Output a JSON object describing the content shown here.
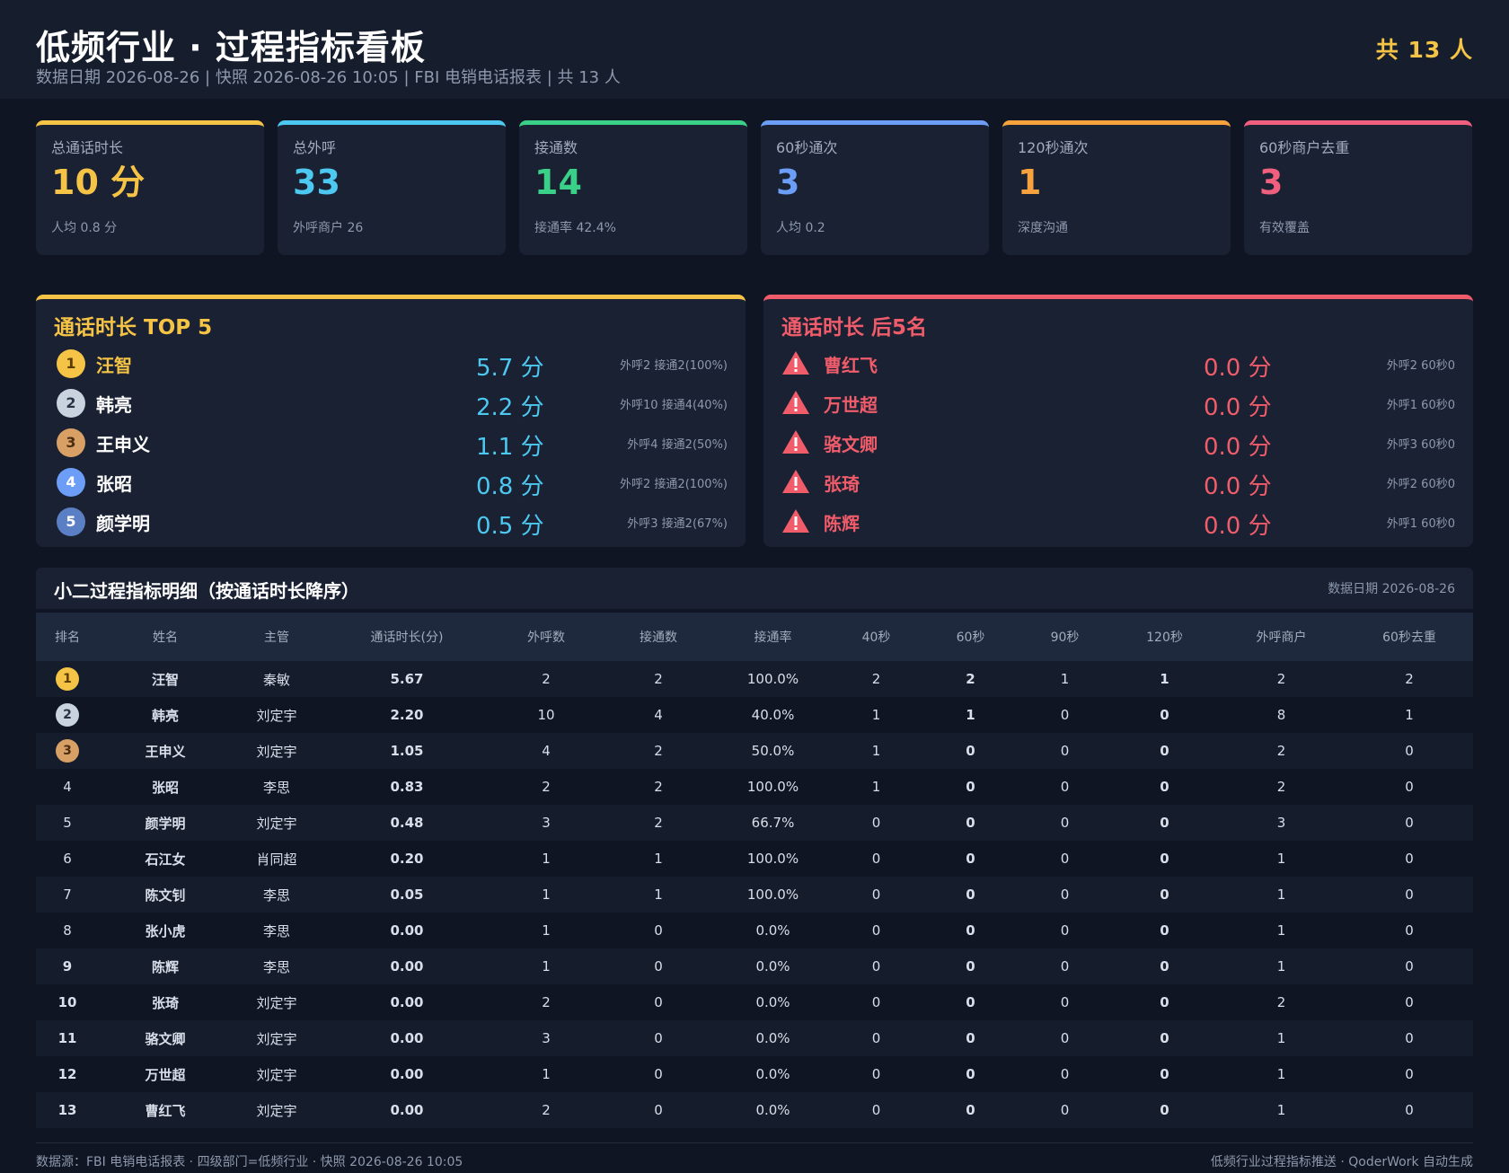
{
  "header": {
    "title": "低频行业 · 过程指标看板",
    "subtitle": "数据日期 2026-08-26 | 快照 2026-08-26 10:05 | FBI 电销电话报表 | 共 13 人",
    "total": "共 13 人"
  },
  "kpis": [
    {
      "label": "总通话时长",
      "value": "10 分",
      "sub": "人均 0.8 分",
      "color": "#f5c345"
    },
    {
      "label": "总外呼",
      "value": "33",
      "sub": "外呼商户 26",
      "color": "#4dc8f0"
    },
    {
      "label": "接通数",
      "value": "14",
      "sub": "接通率 42.4%",
      "color": "#3bd088"
    },
    {
      "label": "60秒通次",
      "value": "3",
      "sub": "人均 0.2",
      "color": "#6c9ef8"
    },
    {
      "label": "120秒通次",
      "value": "1",
      "sub": "深度沟通",
      "color": "#f7a23c"
    },
    {
      "label": "60秒商户去重",
      "value": "3",
      "sub": "有效覆盖",
      "color": "#f0607e"
    }
  ],
  "top5": {
    "title": "通话时长 TOP 5",
    "items": [
      {
        "rank": "1",
        "name": "汪智",
        "value": "5.7 分",
        "meta": "外呼2 接通2(100%)"
      },
      {
        "rank": "2",
        "name": "韩亮",
        "value": "2.2 分",
        "meta": "外呼10 接通4(40%)"
      },
      {
        "rank": "3",
        "name": "王申义",
        "value": "1.1 分",
        "meta": "外呼4 接通2(50%)"
      },
      {
        "rank": "4",
        "name": "张昭",
        "value": "0.8 分",
        "meta": "外呼2 接通2(100%)"
      },
      {
        "rank": "5",
        "name": "颜学明",
        "value": "0.5 分",
        "meta": "外呼3 接通2(67%)"
      }
    ]
  },
  "bottom5": {
    "title": "通话时长 后5名",
    "items": [
      {
        "name": "曹红飞",
        "value": "0.0 分",
        "meta": "外呼2 60秒0"
      },
      {
        "name": "万世超",
        "value": "0.0 分",
        "meta": "外呼1 60秒0"
      },
      {
        "name": "骆文卿",
        "value": "0.0 分",
        "meta": "外呼3 60秒0"
      },
      {
        "name": "张琦",
        "value": "0.0 分",
        "meta": "外呼2 60秒0"
      },
      {
        "name": "陈辉",
        "value": "0.0 分",
        "meta": "外呼1 60秒0"
      }
    ]
  },
  "table": {
    "title": "小二过程指标明细（按通话时长降序）",
    "date": "数据日期 2026-08-26",
    "columns": [
      "排名",
      "姓名",
      "主管",
      "通话时长(分)",
      "外呼数",
      "接通数",
      "接通率",
      "40秒",
      "60秒",
      "90秒",
      "120秒",
      "外呼商户",
      "60秒去重"
    ],
    "rows": [
      [
        "1",
        "汪智",
        "秦敏",
        "5.67",
        "2",
        "2",
        "100.0%",
        "2",
        "2",
        "1",
        "1",
        "2",
        "2"
      ],
      [
        "2",
        "韩亮",
        "刘定宇",
        "2.20",
        "10",
        "4",
        "40.0%",
        "1",
        "1",
        "0",
        "0",
        "8",
        "1"
      ],
      [
        "3",
        "王申义",
        "刘定宇",
        "1.05",
        "4",
        "2",
        "50.0%",
        "1",
        "0",
        "0",
        "0",
        "2",
        "0"
      ],
      [
        "4",
        "张昭",
        "李思",
        "0.83",
        "2",
        "2",
        "100.0%",
        "1",
        "0",
        "0",
        "0",
        "2",
        "0"
      ],
      [
        "5",
        "颜学明",
        "刘定宇",
        "0.48",
        "3",
        "2",
        "66.7%",
        "0",
        "0",
        "0",
        "0",
        "3",
        "0"
      ],
      [
        "6",
        "石江女",
        "肖同超",
        "0.20",
        "1",
        "1",
        "100.0%",
        "0",
        "0",
        "0",
        "0",
        "1",
        "0"
      ],
      [
        "7",
        "陈文钊",
        "李思",
        "0.05",
        "1",
        "1",
        "100.0%",
        "0",
        "0",
        "0",
        "0",
        "1",
        "0"
      ],
      [
        "8",
        "张小虎",
        "李思",
        "0.00",
        "1",
        "0",
        "0.0%",
        "0",
        "0",
        "0",
        "0",
        "1",
        "0"
      ],
      [
        "9",
        "陈辉",
        "李思",
        "0.00",
        "1",
        "0",
        "0.0%",
        "0",
        "0",
        "0",
        "0",
        "1",
        "0"
      ],
      [
        "10",
        "张琦",
        "刘定宇",
        "0.00",
        "2",
        "0",
        "0.0%",
        "0",
        "0",
        "0",
        "0",
        "2",
        "0"
      ],
      [
        "11",
        "骆文卿",
        "刘定宇",
        "0.00",
        "3",
        "0",
        "0.0%",
        "0",
        "0",
        "0",
        "0",
        "1",
        "0"
      ],
      [
        "12",
        "万世超",
        "刘定宇",
        "0.00",
        "1",
        "0",
        "0.0%",
        "0",
        "0",
        "0",
        "0",
        "1",
        "0"
      ],
      [
        "13",
        "曹红飞",
        "刘定宇",
        "0.00",
        "2",
        "0",
        "0.0%",
        "0",
        "0",
        "0",
        "0",
        "1",
        "0"
      ]
    ]
  },
  "footer": {
    "left": "数据源：FBI 电销电话报表 · 四级部门=低频行业 · 快照 2026-08-26 10:05",
    "right": "低频行业过程指标推送 · QoderWork 自动生成"
  },
  "colors": {
    "gold": "#f5c345",
    "silver": "#c9d3e0",
    "bronze": "#d9a066",
    "medal4": "#6c9ef8",
    "medal5": "#5b7fc4",
    "alert": "#f05c6a"
  }
}
